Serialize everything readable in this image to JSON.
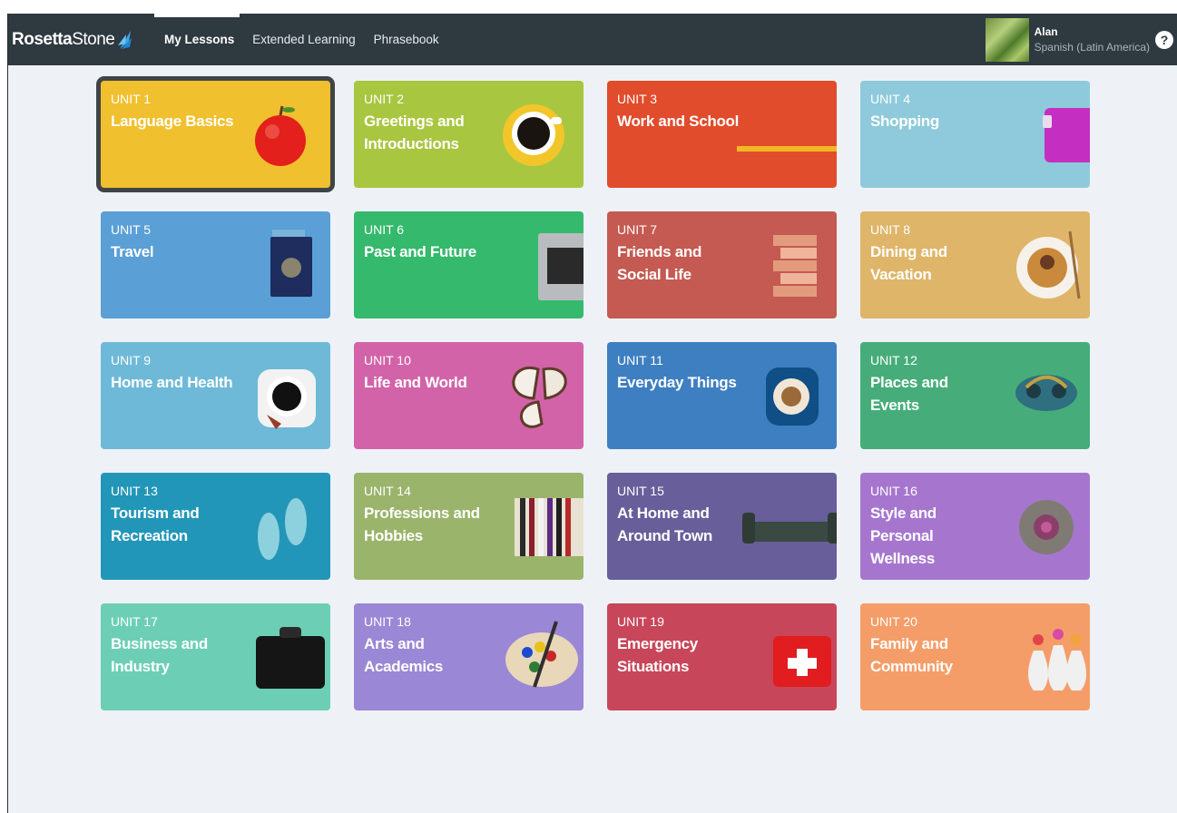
{
  "brand": {
    "name_bold": "Rosetta",
    "name_light": "Stone"
  },
  "nav": [
    {
      "label": "My Lessons",
      "active": true
    },
    {
      "label": "Extended Learning",
      "active": false
    },
    {
      "label": "Phrasebook",
      "active": false
    }
  ],
  "user": {
    "name": "Alan",
    "language": "Spanish (Latin America)"
  },
  "help_label": "?",
  "units": [
    {
      "unit": "UNIT 1",
      "title": "Language Basics",
      "color": "#f0c02f",
      "icon": "apple-icon",
      "selected": true
    },
    {
      "unit": "UNIT 2",
      "title": "Greetings and Introductions",
      "color": "#a9c640",
      "icon": "coffee-cup-icon"
    },
    {
      "unit": "UNIT 3",
      "title": "Work and School",
      "color": "#e14c2c",
      "icon": "pencil-icon"
    },
    {
      "unit": "UNIT 4",
      "title": "Shopping",
      "color": "#8ecadb",
      "icon": "wallet-icon"
    },
    {
      "unit": "UNIT 5",
      "title": "Travel",
      "color": "#5a9fd6",
      "icon": "passport-icon"
    },
    {
      "unit": "UNIT 6",
      "title": "Past and Future",
      "color": "#35b96c",
      "icon": "laptop-icon"
    },
    {
      "unit": "UNIT 7",
      "title": "Friends and Social Life",
      "color": "#c45a51",
      "icon": "blocks-tower-icon"
    },
    {
      "unit": "UNIT 8",
      "title": "Dining and Vacation",
      "color": "#dfb569",
      "icon": "pasta-plate-icon"
    },
    {
      "unit": "UNIT 9",
      "title": "Home and Health",
      "color": "#6eb9d8",
      "icon": "tea-cup-icon"
    },
    {
      "unit": "UNIT 10",
      "title": "Life and World",
      "color": "#d363a8",
      "icon": "butterfly-icon"
    },
    {
      "unit": "UNIT 11",
      "title": "Everyday Things",
      "color": "#3e7fc1",
      "icon": "latte-icon"
    },
    {
      "unit": "UNIT 12",
      "title": "Places and Events",
      "color": "#46ad7a",
      "icon": "carnival-mask-icon"
    },
    {
      "unit": "UNIT 13",
      "title": "Tourism and Recreation",
      "color": "#2296b8",
      "icon": "flip-flops-icon"
    },
    {
      "unit": "UNIT 14",
      "title": "Professions and Hobbies",
      "color": "#9bb46b",
      "icon": "books-icon"
    },
    {
      "unit": "UNIT 15",
      "title": "At Home and Around Town",
      "color": "#685e9a",
      "icon": "sofa-icon"
    },
    {
      "unit": "UNIT 16",
      "title": "Style and Personal Wellness",
      "color": "#a676cf",
      "icon": "flower-stone-icon"
    },
    {
      "unit": "UNIT 17",
      "title": "Business and Industry",
      "color": "#6ccfb5",
      "icon": "briefcase-icon"
    },
    {
      "unit": "UNIT 18",
      "title": "Arts and Academics",
      "color": "#9a87d5",
      "icon": "paint-palette-icon"
    },
    {
      "unit": "UNIT 19",
      "title": "Emergency Situations",
      "color": "#c84659",
      "icon": "first-aid-kit-icon"
    },
    {
      "unit": "UNIT 20",
      "title": "Family and Community",
      "color": "#f59d68",
      "icon": "flower-vases-icon"
    }
  ]
}
